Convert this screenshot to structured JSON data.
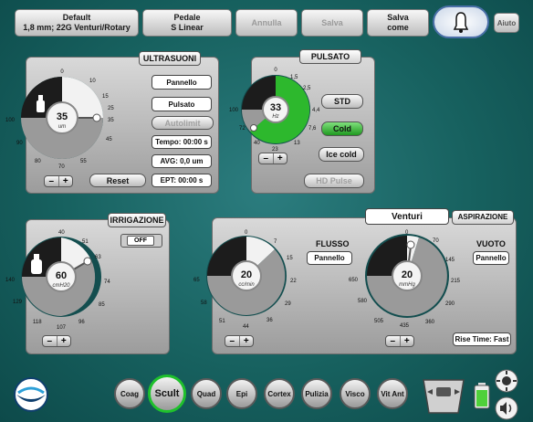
{
  "top": {
    "profile": {
      "line1": "Default",
      "line2": "1,8 mm; 22G Venturi/Rotary"
    },
    "pedal": {
      "line1": "Pedale",
      "line2": "S Linear"
    },
    "cancel": "Annulla",
    "save": "Salva",
    "save_as": {
      "line1": "Salva",
      "line2": "come"
    },
    "help": "Aiuto"
  },
  "ultrasound": {
    "title": "ULTRASUONI",
    "dial": {
      "value": "35",
      "unit": "um",
      "max_level": 35,
      "ticks": [
        "0",
        "10",
        "15",
        "25",
        "35",
        "45",
        "55",
        "70",
        "80",
        "90",
        "100"
      ]
    },
    "panel_btn": "Pannello",
    "mode_btn": "Pulsato",
    "autolimit": "Autolimit",
    "time": "Tempo: 00:00 s",
    "avg": "AVG: 0,0 um",
    "ept": "EPT: 00:00 s",
    "reset": "Reset"
  },
  "pulsed": {
    "title": "PULSATO",
    "dial": {
      "value": "33",
      "unit": "Hz",
      "ticks": [
        "0",
        "1,5",
        "2,5",
        "4,4",
        "7,6",
        "13",
        "23",
        "40",
        "72",
        "100"
      ]
    },
    "std": "STD",
    "cold": "Cold",
    "ice_cold": "Ice cold",
    "hd_pulse": "HD Pulse"
  },
  "irrigation": {
    "title": "IRRIGAZIONE",
    "toggle": "OFF",
    "dial": {
      "value": "60",
      "unit": "cmH20",
      "ticks": [
        "40",
        "51",
        "63",
        "74",
        "85",
        "96",
        "107",
        "118",
        "129",
        "140"
      ]
    }
  },
  "aspiration": {
    "tab_venturi": "Venturi",
    "title": "ASPIRAZIONE",
    "flow": {
      "label": "FLUSSO",
      "btn": "Pannello",
      "value": "20",
      "unit": "cc/min",
      "ticks": [
        "0",
        "7",
        "15",
        "22",
        "29",
        "36",
        "44",
        "51",
        "58",
        "65"
      ]
    },
    "vacuum": {
      "label": "VUOTO",
      "btn": "Pannello",
      "value": "20",
      "unit": "mmHg",
      "ticks": [
        "0",
        "70",
        "145",
        "215",
        "290",
        "360",
        "435",
        "505",
        "580",
        "650"
      ]
    },
    "rise_time": "Rise Time: Fast"
  },
  "modes": [
    "Coag",
    "Scult",
    "Quad",
    "Epi",
    "Cortex",
    "Pulizia",
    "Visco",
    "Vit Ant"
  ],
  "active_mode": "Scult",
  "colors": {
    "active": "#1fc12c",
    "pulse_green": "#2db82d"
  }
}
